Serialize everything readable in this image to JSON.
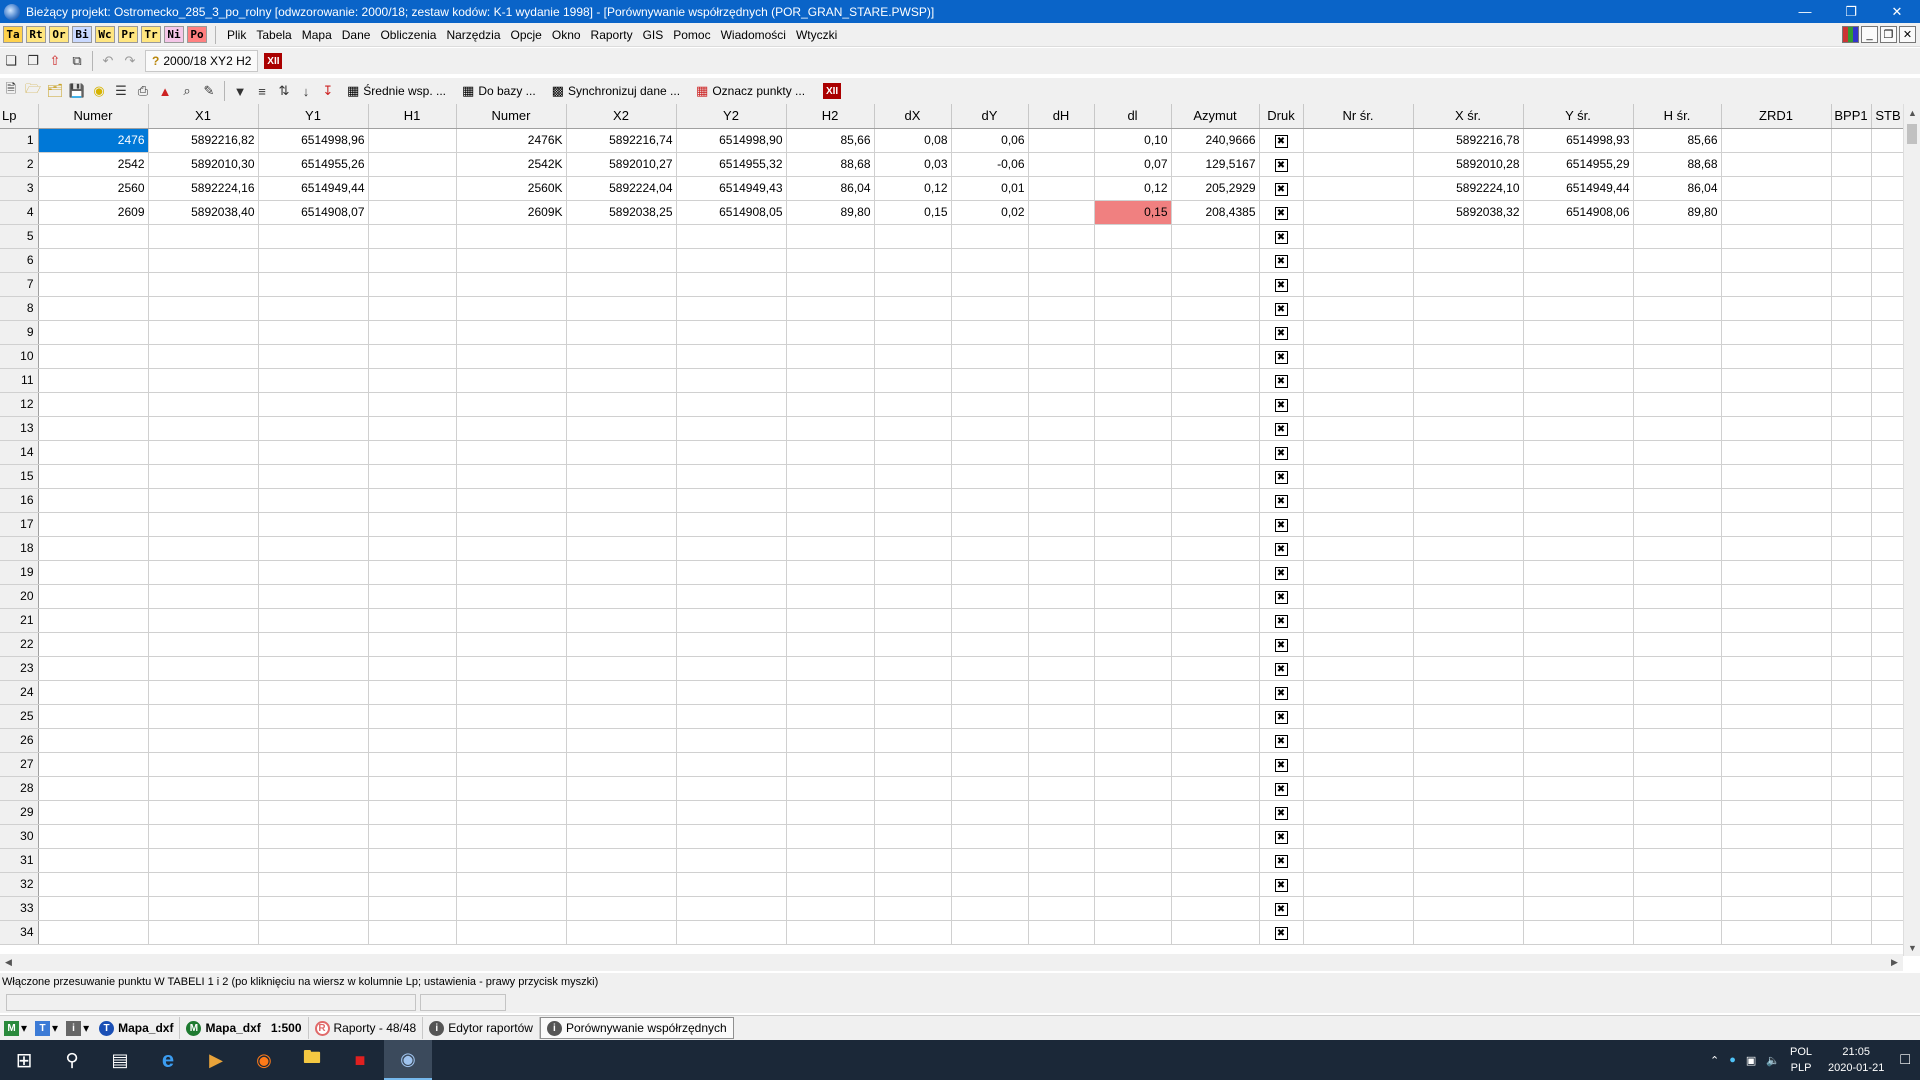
{
  "window": {
    "title": "Bieżący projekt: Ostromecko_285_3_po_rolny [odwzorowanie: 2000/18; zestaw kodów: K-1 wydanie 1998] - [Porównywanie współrzędnych (POR_GRAN_STARE.PWSP)]"
  },
  "modules": [
    "Ta",
    "Rt",
    "Or",
    "Bi",
    "Wc",
    "Pr",
    "Tr",
    "Ni",
    "Po"
  ],
  "menu": [
    "Plik",
    "Tabela",
    "Mapa",
    "Dane",
    "Obliczenia",
    "Narzędzia",
    "Opcje",
    "Okno",
    "Raporty",
    "GIS",
    "Pomoc",
    "Wiadomości",
    "Wtyczki"
  ],
  "toolbar": {
    "coord_system": "2000/18 XY2 H2",
    "buttons": {
      "avg": "Średnie wsp. ...",
      "todb": "Do bazy ...",
      "sync": "Synchronizuj dane ...",
      "mark": "Oznacz punkty ..."
    }
  },
  "table": {
    "columns": [
      "Lp",
      "Numer",
      "X1",
      "Y1",
      "H1",
      "Numer",
      "X2",
      "Y2",
      "H2",
      "dX",
      "dY",
      "dH",
      "dl",
      "Azymut",
      "Druk",
      "Nr śr.",
      "X śr.",
      "Y śr.",
      "H śr.",
      "ZRD1",
      "BPP1",
      "STB"
    ],
    "rows": [
      [
        "1",
        "2476",
        "5892216,82",
        "6514998,96",
        "",
        "2476K",
        "5892216,74",
        "6514998,90",
        "85,66",
        "0,08",
        "0,06",
        "",
        "0,10",
        "240,9666",
        "x",
        "",
        "5892216,78",
        "6514998,93",
        "85,66",
        "",
        "",
        ""
      ],
      [
        "2",
        "2542",
        "5892010,30",
        "6514955,26",
        "",
        "2542K",
        "5892010,27",
        "6514955,32",
        "88,68",
        "0,03",
        "-0,06",
        "",
        "0,07",
        "129,5167",
        "x",
        "",
        "5892010,28",
        "6514955,29",
        "88,68",
        "",
        "",
        ""
      ],
      [
        "3",
        "2560",
        "5892224,16",
        "6514949,44",
        "",
        "2560K",
        "5892224,04",
        "6514949,43",
        "86,04",
        "0,12",
        "0,01",
        "",
        "0,12",
        "205,2929",
        "x",
        "",
        "5892224,10",
        "6514949,44",
        "86,04",
        "",
        "",
        ""
      ],
      [
        "4",
        "2609",
        "5892038,40",
        "6514908,07",
        "",
        "2609K",
        "5892038,25",
        "6514908,05",
        "89,80",
        "0,15",
        "0,02",
        "",
        "0,15",
        "208,4385",
        "x",
        "",
        "5892038,32",
        "6514908,06",
        "89,80",
        "",
        "",
        ""
      ]
    ],
    "empty_rows": [
      "5",
      "6",
      "7",
      "8",
      "9",
      "10",
      "11",
      "12",
      "13",
      "14",
      "15",
      "16",
      "17",
      "18",
      "19",
      "20",
      "21",
      "22",
      "23",
      "24",
      "25",
      "26",
      "27",
      "28",
      "29",
      "30",
      "31",
      "32",
      "33",
      "34"
    ],
    "selected_cell": {
      "row": 0,
      "col": 1
    },
    "highlighted_cell": {
      "row": 3,
      "col": 12,
      "color": "#f08080"
    },
    "selection_color": "#0078d7"
  },
  "status": {
    "message": "Włączone przesuwanie punktu W TABELI 1 i 2 (po kliknięciu na wiersz w kolumnie Lp; ustawienia - prawy przycisk myszki)"
  },
  "docbar": {
    "mode_buttons": [
      "M",
      "T",
      "i"
    ],
    "tabs": [
      {
        "icon": "T",
        "label": "Mapa_dxf",
        "color": "#1a4fb5"
      },
      {
        "icon": "M",
        "label": "Mapa_dxf",
        "extra": "1:500",
        "color": "#1e7a30"
      },
      {
        "icon": "R",
        "label": "Raporty - 48/48",
        "color": "#e06a6a"
      },
      {
        "icon": "i",
        "label": "Edytor raportów",
        "color": "#555555"
      },
      {
        "icon": "i",
        "label": "Porównywanie współrzędnych",
        "color": "#555555"
      }
    ]
  },
  "taskbar": {
    "lang_top": "POL",
    "lang_bottom": "PLP",
    "time": "21:05",
    "date": "2020-01-21"
  }
}
